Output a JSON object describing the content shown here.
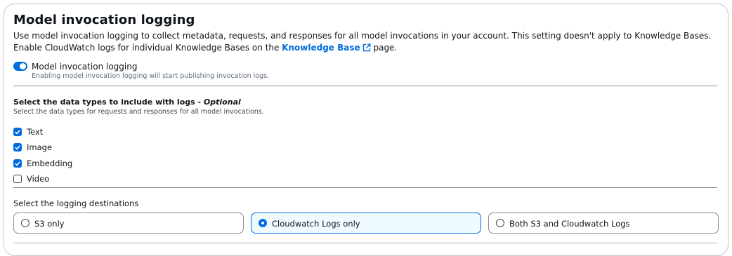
{
  "section": {
    "title": "Model invocation logging",
    "description_part1": "Use model invocation logging to collect metadata, requests, and responses for all model invocations in your account. This setting doesn't apply to Knowledge Bases. Enable CloudWatch logs for individual Knowledge Bases on the ",
    "description_link": "Knowledge Base",
    "description_part2": " page."
  },
  "toggle": {
    "label": "Model invocation logging",
    "description": "Enabling model invocation logging will start publishing invocation logs.",
    "checked": true
  },
  "data_types": {
    "title": "Select the data types to include with logs - ",
    "optional": "Optional",
    "description": "Select the data types for requests and responses for all model invocations.",
    "options": [
      {
        "label": "Text",
        "checked": true
      },
      {
        "label": "Image",
        "checked": true
      },
      {
        "label": "Embedding",
        "checked": true
      },
      {
        "label": "Video",
        "checked": false
      }
    ]
  },
  "destinations": {
    "label": "Select the logging destinations",
    "options": [
      {
        "label": "S3 only",
        "selected": false
      },
      {
        "label": "Cloudwatch Logs only",
        "selected": true
      },
      {
        "label": "Both S3 and Cloudwatch Logs",
        "selected": false
      }
    ]
  },
  "colors": {
    "accent": "#006ce0",
    "selected_card_bg": "#f0fbff",
    "divider": "#8c8c94"
  },
  "icons": {
    "external_link": "external-link-icon",
    "checkmark": "checkmark-icon"
  }
}
